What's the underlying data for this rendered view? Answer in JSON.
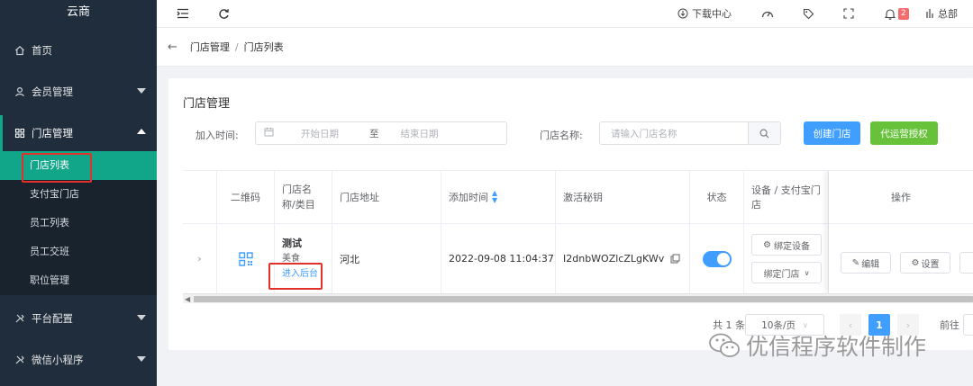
{
  "sidebar": {
    "brand": "云商",
    "home": "首页",
    "member": "会员管理",
    "store": "门店管理",
    "store_sub": [
      "门店列表",
      "支付宝门店",
      "员工列表",
      "员工交班",
      "职位管理"
    ],
    "platform": "平台配置",
    "miniapp": "微信小程序"
  },
  "topbar": {
    "download": "下载中心",
    "bell_count": "2",
    "user": "总部"
  },
  "breadcrumb": {
    "parent": "门店管理",
    "sep": "/",
    "current": "门店列表"
  },
  "card": {
    "title": "门店管理",
    "filter": {
      "join_time_label": "加入时间:",
      "start_placeholder": "开始日期",
      "to": "至",
      "end_placeholder": "结束日期",
      "name_label": "门店名称:",
      "name_placeholder": "请输入门店名称"
    },
    "create_button": "创建门店",
    "auth_button": "代运营授权"
  },
  "table": {
    "headers": {
      "qr": "二维码",
      "name_line1": "门店名",
      "name_line2": "称/类目",
      "address": "门店地址",
      "added": "添加时间",
      "secret": "激活秘钥",
      "status": "状态",
      "device": "设备 / 支付宝门店",
      "ops": "操作"
    },
    "row": {
      "name": "测试",
      "category": "美食",
      "enter_backend": "进入后台",
      "address": "河北",
      "added": "2022-09-08 11:04:37",
      "secret": "I2dnbWOZlcZLgKWv",
      "status_on": true,
      "bind_device": "绑定设备",
      "bind_store": "绑定门店",
      "edit": "编辑",
      "settings": "设置"
    }
  },
  "pagination": {
    "total": "共 1 条",
    "page_size": "10条/页",
    "current": "1",
    "goto": "前往"
  },
  "watermark": "优信程序软件制作",
  "colors": {
    "sidebar_bg": "#1f2d3d",
    "active_teal": "#11a58a",
    "primary_blue": "#409eff",
    "success_green": "#67c23a",
    "highlight_red": "#e0312b"
  }
}
